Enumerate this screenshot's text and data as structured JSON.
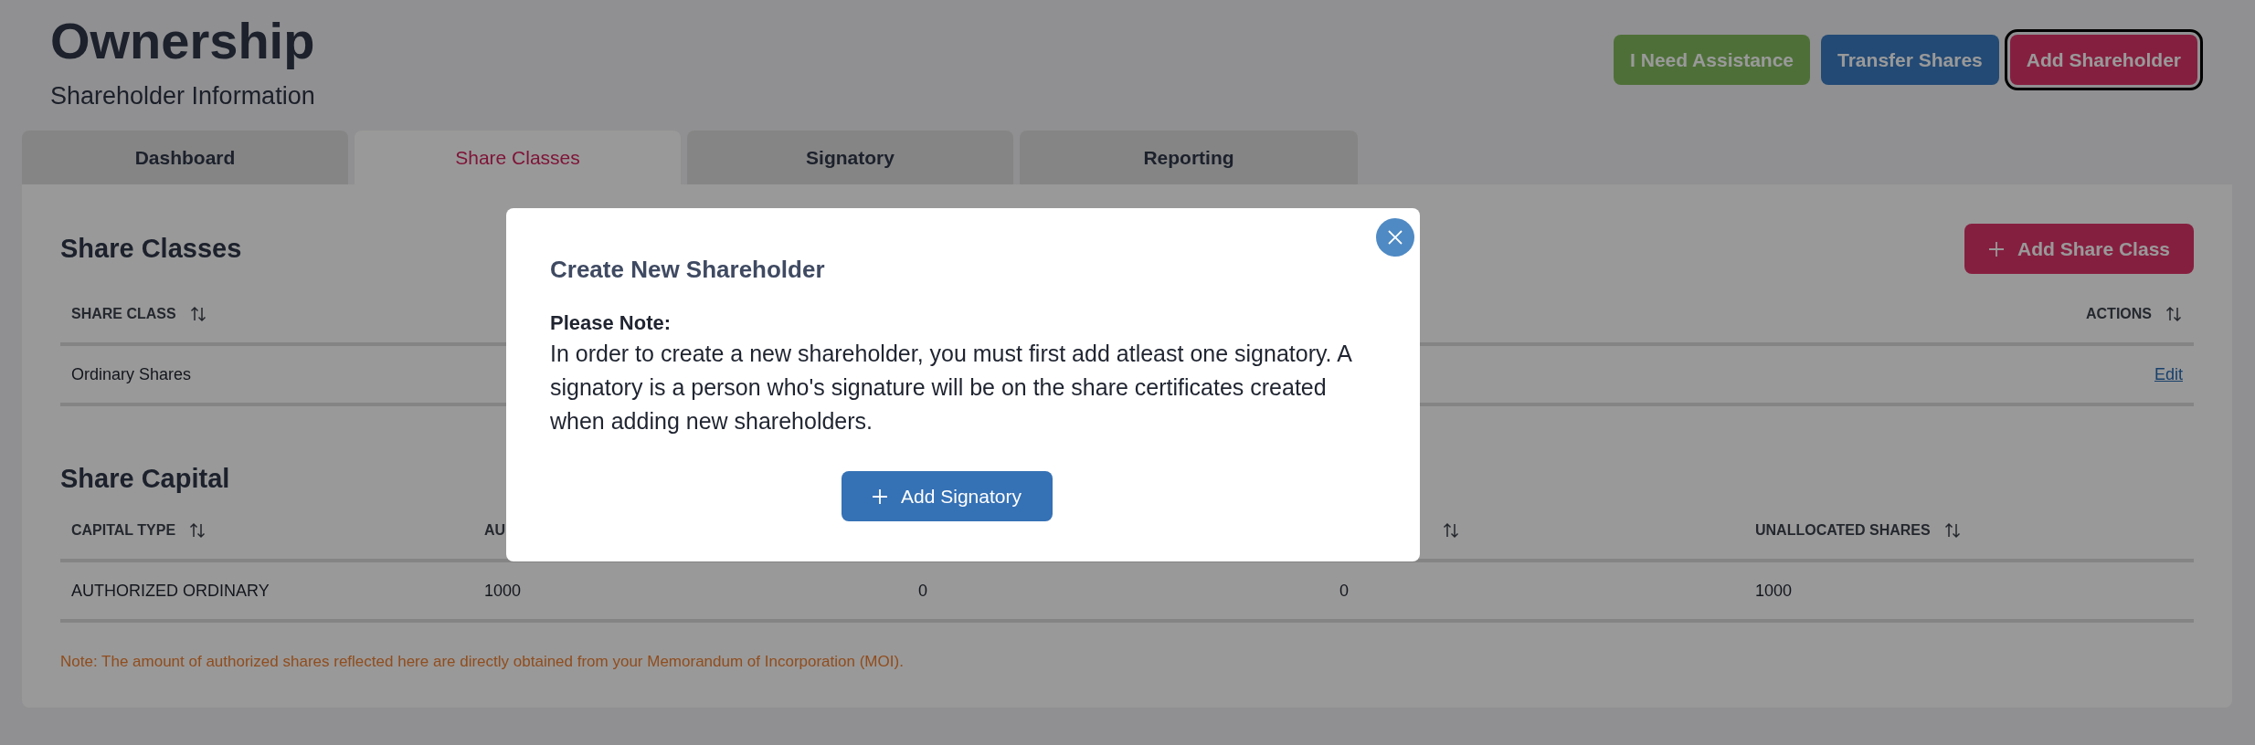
{
  "header": {
    "title": "Ownership",
    "subtitle": "Shareholder Information"
  },
  "actions": [
    {
      "label": "I Need Assistance",
      "kind": "assist",
      "focused": false
    },
    {
      "label": "Transfer Shares",
      "kind": "transfer",
      "focused": false
    },
    {
      "label": "Add Shareholder",
      "kind": "add",
      "focused": true
    }
  ],
  "tabs": [
    {
      "label": "Dashboard",
      "selected": false
    },
    {
      "label": "Share Classes",
      "selected": true
    },
    {
      "label": "Signatory",
      "selected": false
    },
    {
      "label": "Reporting",
      "selected": false
    }
  ],
  "share_classes": {
    "title": "Share Classes",
    "add_button": "Add Share Class",
    "columns": [
      {
        "label": "SHARE CLASS",
        "sortable": true
      },
      {
        "label": "ACTIONS",
        "sortable": true
      }
    ],
    "rows": [
      {
        "name": "Ordinary Shares",
        "action": "Edit"
      }
    ]
  },
  "share_capital": {
    "title": "Share Capital",
    "columns": [
      {
        "label": "CAPITAL TYPE",
        "sortable": true
      },
      {
        "label": "AU"
      },
      {},
      {
        "sortable": true
      },
      {
        "label": "UNALLOCATED SHARES",
        "sortable": true
      }
    ],
    "rows": [
      {
        "cells": [
          "AUTHORIZED ORDINARY",
          "1000",
          "0",
          "0",
          "1000"
        ]
      }
    ],
    "note": "Note: The amount of authorized shares reflected here are directly obtained from your Memorandum of Incorporation (MOI)."
  },
  "modal": {
    "title": "Create New Shareholder",
    "note_label": "Please Note:",
    "message": "In order to create a new shareholder, you must first add atleast one signatory. A signatory is a person who's signature will be on the share certificates created when adding new shareholders.",
    "button": "Add Signatory"
  }
}
